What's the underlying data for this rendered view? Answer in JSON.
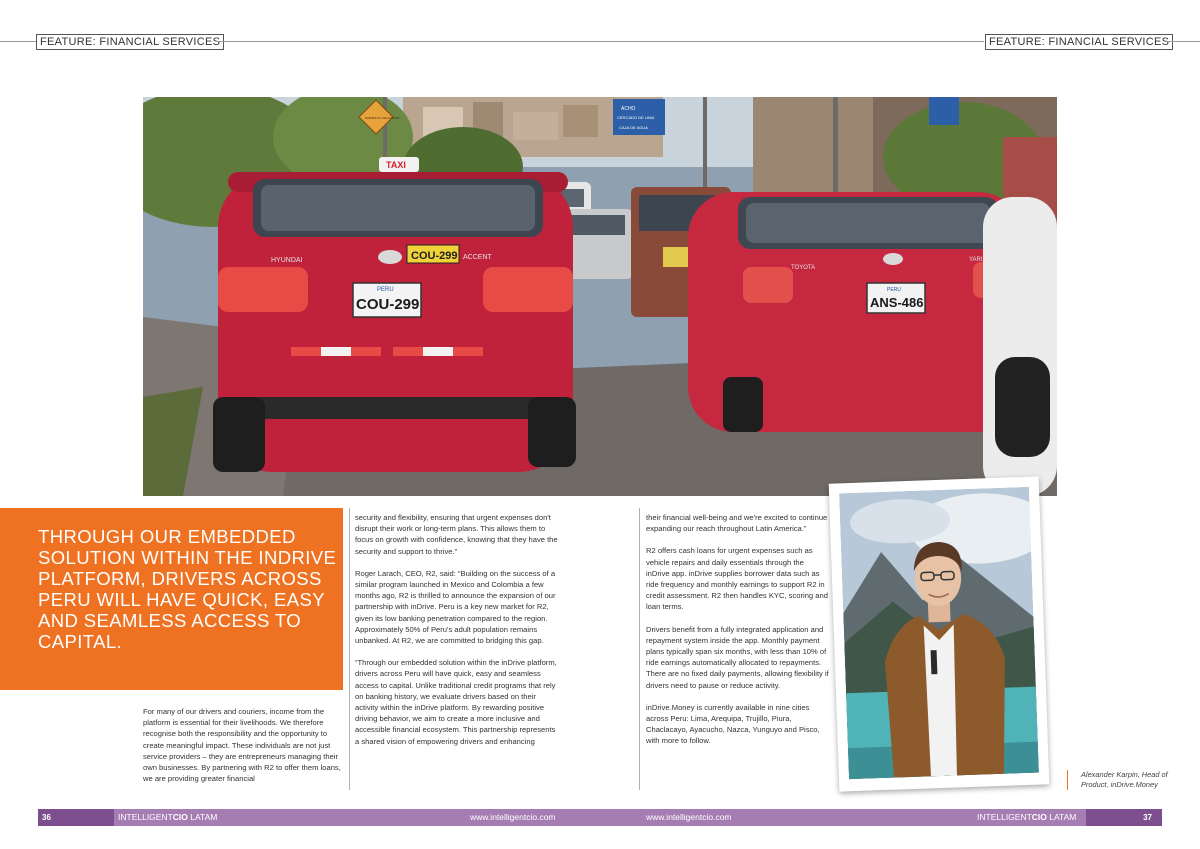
{
  "header": {
    "left_tag": "FEATURE: FINANCIAL SERVICES",
    "right_tag": "FEATURE: FINANCIAL SERVICES"
  },
  "pull_quote": "Through our embedded solution within the inDrive platform, drivers across Peru will have quick, easy and seamless access to capital.",
  "photo": {
    "sign_blue_1": "ACHO",
    "sign_blue_2": "CERCADO DE LIMA",
    "sign_blue_3": "CAJA DE AGUA",
    "sign_yellow": "DISMINUYA VELOCIDAD",
    "taxi_roof": "TAXI",
    "plate_left": "COU-299",
    "plate_left_country": "PERU",
    "plate_left_sticker": "COU-299",
    "badge_left_brand": "HYUNDAI",
    "badge_left_model": "ACCENT",
    "plate_right": "ANS-486",
    "plate_right_country": "PERU",
    "badge_right_brand": "TOYOTA",
    "badge_right_model": "YARIS"
  },
  "columns": {
    "col1": [
      "For many of our drivers and couriers, income from the platform is essential for their livelihoods. We therefore recognise both the responsibility and the opportunity to create meaningful impact. These individuals are not just service providers – they are entrepreneurs managing their own businesses. By partnering with R2 to offer them loans, we are providing greater financial"
    ],
    "col2": [
      "security and flexibility, ensuring that urgent expenses don't disrupt their work or long-term plans. This allows them to focus on growth with confidence, knowing that they have the security and support to thrive.”",
      "Roger Larach, CEO, R2, said: “Building on the success of a similar program launched in Mexico and Colombia a few months ago, R2 is thrilled to announce the expansion of our partnership with inDrive. Peru is a key new market for R2, given its low banking penetration compared to the region. Approximately 50% of Peru's adult population remains unbanked. At R2, we are committed to bridging this gap.",
      "“Through our embedded solution within the inDrive platform, drivers across Peru will have quick, easy and seamless access to capital. Unlike traditional credit programs that rely on banking history, we evaluate drivers based on their activity within the inDrive platform. By rewarding positive driving behavior, we aim to create a more inclusive and accessible financial ecosystem. This partnership represents a shared vision of empowering drivers and enhancing"
    ],
    "col3": [
      "their financial well-being and we're excited to continue expanding our reach throughout Latin America.”",
      "R2 offers cash loans for urgent expenses such as vehicle repairs and daily essentials through the inDrive app. inDrive supplies borrower data such as ride frequency and monthly earnings to support R2 in credit assessment. R2 then handles KYC, scoring and loan terms.",
      "Drivers benefit from a fully integrated application and repayment system inside the app. Monthly payment plans typically span six months, with less than 10% of ride earnings automatically allocated to repayments. There are no fixed daily payments, allowing flexibility if drivers need to pause or reduce activity.",
      "inDrive.Money is currently available in nine cities across Peru: Lima, Arequipa, Trujillo, Piura, Chaclacayo, Ayacucho, Nazca, Yunguyo and Pisco, with more to follow."
    ]
  },
  "caption": "Alexander Karpin, Head of Product, inDrive.Money",
  "footer": {
    "page_left": "36",
    "brand_left_prefix": "INTELLIGENT",
    "brand_left_bold": "CIO",
    "brand_left_suffix": " LATAM",
    "url_left": "www.intelligentcio.com",
    "url_right": "www.intelligentcio.com",
    "brand_right_prefix": "INTELLIGENT",
    "brand_right_bold": "CIO",
    "brand_right_suffix": " LATAM",
    "page_right": "37"
  },
  "colors": {
    "accent_orange": "#ee7221",
    "footer_purple": "#a67db3",
    "footer_purple_dark": "#7d4f8e"
  }
}
